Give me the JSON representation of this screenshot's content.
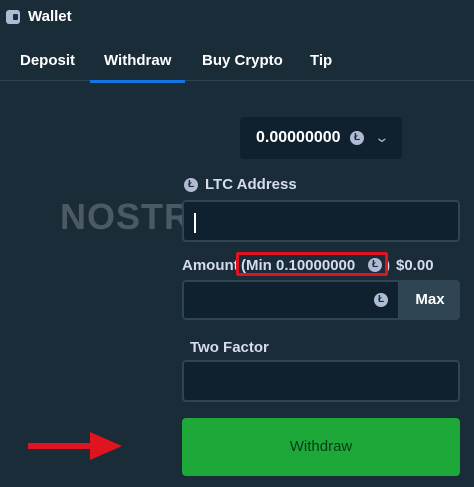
{
  "header": {
    "title": "Wallet",
    "icon": "wallet-icon"
  },
  "tabs": [
    {
      "label": "Deposit",
      "active": false
    },
    {
      "label": "Withdraw",
      "active": true
    },
    {
      "label": "Buy Crypto",
      "active": false
    },
    {
      "label": "Tip",
      "active": false
    }
  ],
  "watermark": "NOSTRABET",
  "balance": {
    "value": "0.00000000",
    "currency_icon": "ltc-icon"
  },
  "address": {
    "label": "LTC Address",
    "value": ""
  },
  "amount": {
    "label": "Amount",
    "min_text": "(Min 0.10000000",
    "min_close": ")",
    "usd_value": "$0.00",
    "value": "",
    "max_label": "Max"
  },
  "two_factor": {
    "label": "Two Factor",
    "value": ""
  },
  "withdraw_button": {
    "label": "Withdraw"
  },
  "colors": {
    "background": "#1a2c38",
    "input_bg": "#0f212e",
    "accent_blue": "#1475e1",
    "button_green": "#1fa83a",
    "highlight_red": "#e0141e"
  }
}
